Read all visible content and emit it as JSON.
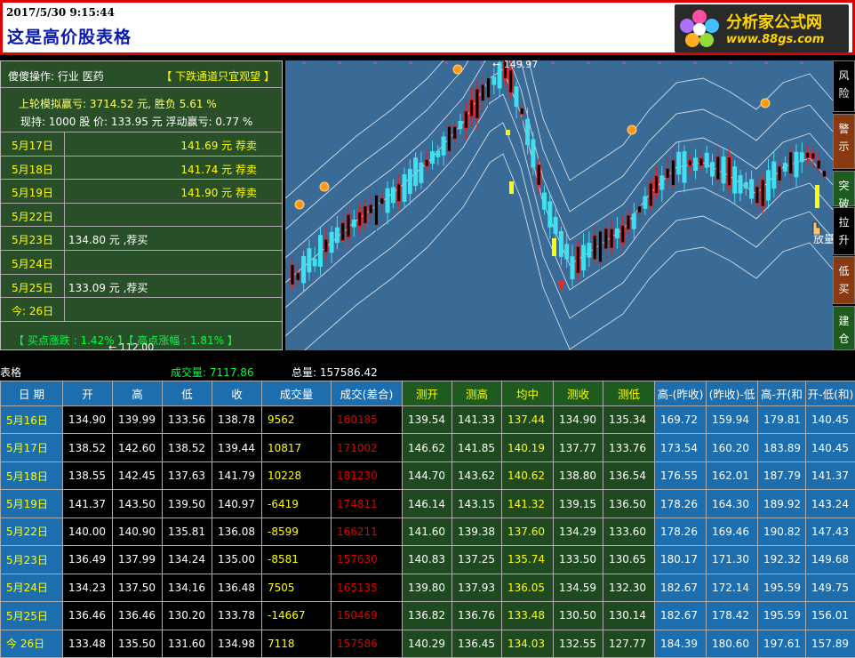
{
  "header": {
    "datetime": "2017/5/30 9:15:44",
    "title": "这是高价股表格",
    "logo_cn": "分析家公式网",
    "logo_url": "www.88gs.com"
  },
  "left_panel": {
    "op_label": "傻傻操作:",
    "industry": "行业  医药",
    "advice": "【 下跌通道只宜观望 】",
    "sim_line1": "上轮模拟赢亏: 3714.52 元,  胜负 5.61 %",
    "sim_line2": "现持: 1000 股  价: 133.95 元    浮动赢亏: 0.77 %",
    "rows": [
      {
        "date": "5月17日",
        "buy": "",
        "sell": "141.69 元 荐卖"
      },
      {
        "date": "5月18日",
        "buy": "",
        "sell": "141.74 元 荐卖"
      },
      {
        "date": "5月19日",
        "buy": "",
        "sell": "141.90 元 荐卖"
      },
      {
        "date": "5月22日",
        "buy": "",
        "sell": ""
      },
      {
        "date": "5月23日",
        "buy": "134.80 元 ,荐买",
        "sell": ""
      },
      {
        "date": "5月24日",
        "buy": "",
        "sell": ""
      },
      {
        "date": "5月25日",
        "buy": "133.09 元 ,荐买",
        "sell": ""
      },
      {
        "date": "今: 26日",
        "buy": "",
        "sell": ""
      }
    ],
    "footer": "【 买点涨跌 : 1.42% 】【 高点涨幅 : 1.81% 】"
  },
  "chart": {
    "high_label": "149.97",
    "low_label": "112.00",
    "cursor_label": "放量跌",
    "colors": {
      "up": "#e02020",
      "down": "#40e0f0",
      "bg": "#3a6a96",
      "band": "#e8e8e8"
    }
  },
  "right_buttons": [
    "风险",
    "警示",
    "突破",
    "拉升",
    "低买",
    "建仓"
  ],
  "info": {
    "label": "表格",
    "vol_label": "成交量: 7117.86",
    "total_label": "总量: 157586.42"
  },
  "table": {
    "headers": [
      "日 期",
      "开",
      "高",
      "低",
      "收",
      "成交量",
      "成交(差合)",
      "测开",
      "测高",
      "均中",
      "测收",
      "测低",
      "高-(昨收)",
      "(昨收)-低",
      "高-开(和",
      "开-低(和)"
    ],
    "rows": [
      [
        "5月16日",
        "134.90",
        "139.99",
        "133.56",
        "138.78",
        "9562",
        "160185",
        "139.54",
        "141.33",
        "137.44",
        "134.90",
        "135.34",
        "169.72",
        "159.94",
        "179.81",
        "140.45"
      ],
      [
        "5月17日",
        "138.52",
        "142.60",
        "138.52",
        "139.44",
        "10817",
        "171002",
        "146.62",
        "141.85",
        "140.19",
        "137.77",
        "133.76",
        "173.54",
        "160.20",
        "183.89",
        "140.45"
      ],
      [
        "5月18日",
        "138.55",
        "142.45",
        "137.63",
        "141.79",
        "10228",
        "181230",
        "144.70",
        "143.62",
        "140.62",
        "138.80",
        "136.54",
        "176.55",
        "162.01",
        "187.79",
        "141.37"
      ],
      [
        "5月19日",
        "141.37",
        "143.50",
        "139.50",
        "140.97",
        "-6419",
        "174811",
        "146.14",
        "143.15",
        "141.32",
        "139.15",
        "136.50",
        "178.26",
        "164.30",
        "189.92",
        "143.24"
      ],
      [
        "5月22日",
        "140.00",
        "140.90",
        "135.81",
        "136.08",
        "-8599",
        "166211",
        "141.60",
        "139.38",
        "137.60",
        "134.29",
        "133.60",
        "178.26",
        "169.46",
        "190.82",
        "147.43"
      ],
      [
        "5月23日",
        "136.49",
        "137.99",
        "134.24",
        "135.00",
        "-8581",
        "157630",
        "140.83",
        "137.25",
        "135.74",
        "133.50",
        "130.65",
        "180.17",
        "171.30",
        "192.32",
        "149.68"
      ],
      [
        "5月24日",
        "134.23",
        "137.50",
        "134.16",
        "136.48",
        "7505",
        "165135",
        "139.80",
        "137.93",
        "136.05",
        "134.59",
        "132.30",
        "182.67",
        "172.14",
        "195.59",
        "149.75"
      ],
      [
        "5月25日",
        "136.46",
        "136.46",
        "130.20",
        "133.78",
        "-14667",
        "150469",
        "136.82",
        "136.76",
        "133.48",
        "130.50",
        "130.14",
        "182.67",
        "178.42",
        "195.59",
        "156.01"
      ],
      [
        "今 26日",
        "133.48",
        "135.50",
        "131.60",
        "134.98",
        "7118",
        "157586",
        "140.29",
        "136.45",
        "134.03",
        "132.55",
        "127.77",
        "184.39",
        "180.60",
        "197.61",
        "157.89"
      ]
    ]
  }
}
